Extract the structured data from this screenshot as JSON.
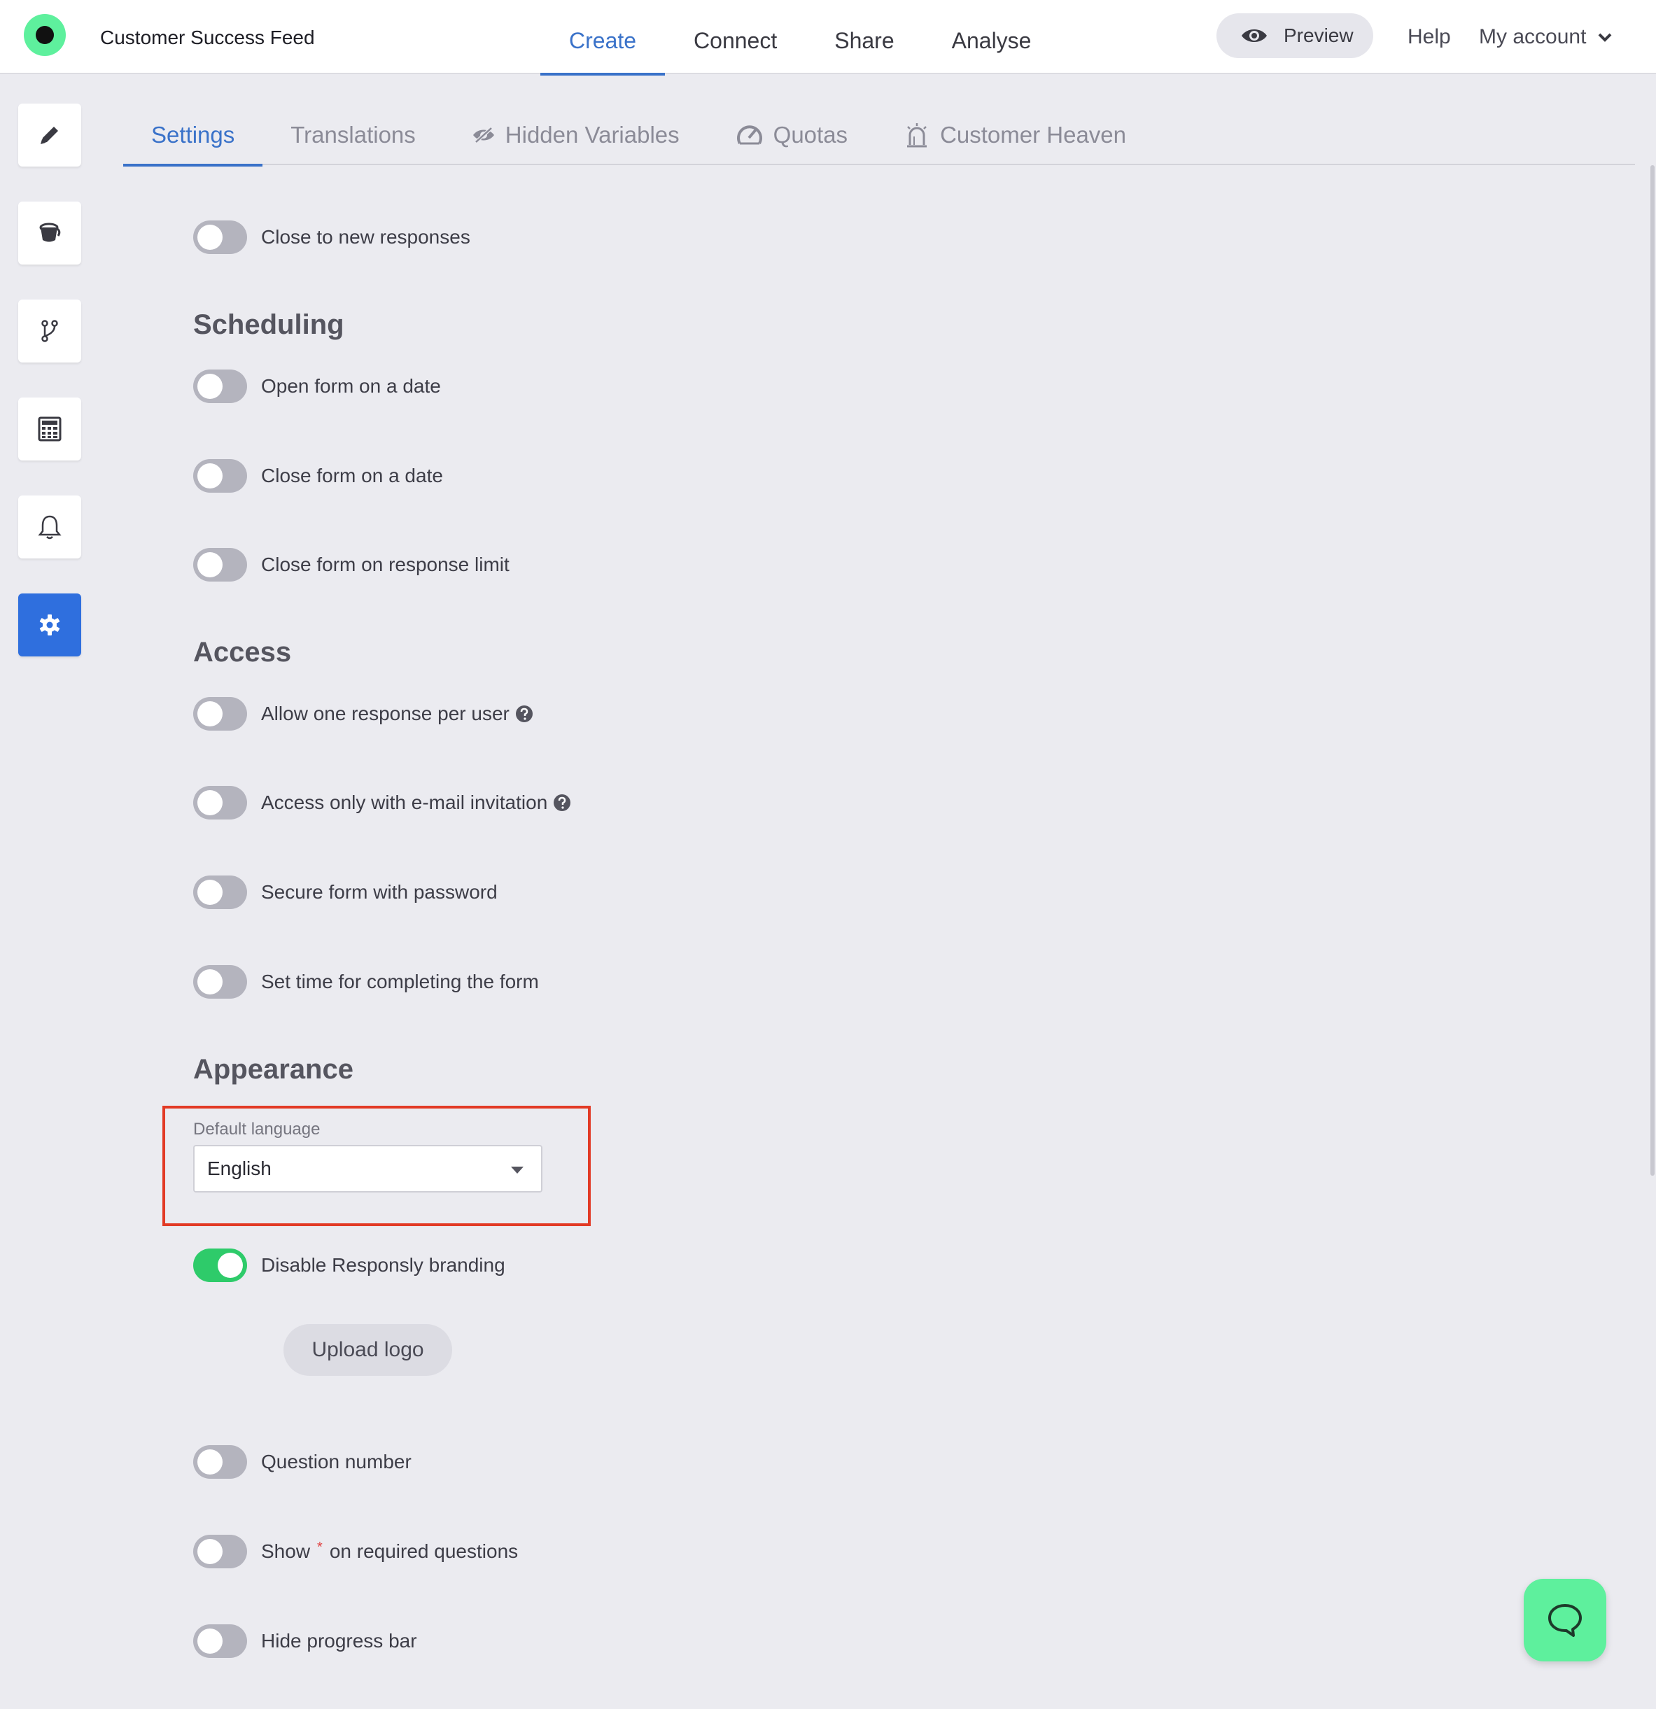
{
  "app": {
    "title": "Customer Success Feed"
  },
  "main_nav": [
    {
      "label": "Create",
      "active": true
    },
    {
      "label": "Connect",
      "active": false
    },
    {
      "label": "Share",
      "active": false
    },
    {
      "label": "Analyse",
      "active": false
    }
  ],
  "header": {
    "preview_label": "Preview",
    "help_label": "Help",
    "account_label": "My account"
  },
  "left_rail": [
    {
      "icon": "pencil-icon",
      "active": false
    },
    {
      "icon": "bucket-icon",
      "active": false
    },
    {
      "icon": "branch-icon",
      "active": false
    },
    {
      "icon": "calculator-icon",
      "active": false
    },
    {
      "icon": "bell-icon",
      "active": false
    },
    {
      "icon": "gear-icon",
      "active": true
    }
  ],
  "sub_tabs": [
    {
      "label": "Settings",
      "active": true
    },
    {
      "label": "Translations",
      "active": false
    },
    {
      "label": "Hidden Variables",
      "icon": "eye-slash-icon",
      "active": false
    },
    {
      "label": "Quotas",
      "icon": "gauge-icon",
      "active": false
    },
    {
      "label": "Customer Heaven",
      "icon": "alarm-icon",
      "active": false
    }
  ],
  "general": {
    "close_new_responses": {
      "label": "Close to new responses",
      "on": false
    }
  },
  "scheduling": {
    "heading": "Scheduling",
    "open_on_date": {
      "label": "Open form on a date",
      "on": false
    },
    "close_on_date": {
      "label": "Close form on a date",
      "on": false
    },
    "close_on_limit": {
      "label": "Close form on response limit",
      "on": false
    }
  },
  "access": {
    "heading": "Access",
    "one_per_user": {
      "label": "Allow one response per user",
      "on": false
    },
    "email_invitation": {
      "label": "Access only with e-mail invitation",
      "on": false
    },
    "password": {
      "label": "Secure form with password",
      "on": false
    },
    "time_limit": {
      "label": "Set time for completing the form",
      "on": false
    }
  },
  "appearance": {
    "heading": "Appearance",
    "default_language_label": "Default language",
    "default_language_value": "English",
    "disable_branding": {
      "label": "Disable Responsly branding",
      "on": true
    },
    "upload_logo_label": "Upload logo",
    "question_number": {
      "label": "Question number",
      "on": false
    },
    "show_required": {
      "label_before": "Show",
      "star": "*",
      "label_after": "on required questions",
      "on": false
    },
    "hide_progress": {
      "label": "Hide progress bar",
      "on": false
    }
  },
  "colors": {
    "accent": "#3a72c9",
    "rail_active": "#2f6fde",
    "toggle_on": "#2ecb6a",
    "toggle_off": "#b4b4be",
    "brand_green": "#5ef09d",
    "highlight": "#e23a25"
  }
}
